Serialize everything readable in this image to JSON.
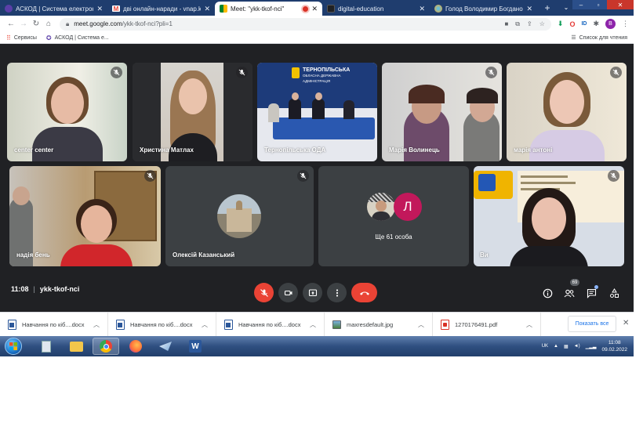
{
  "tabs": [
    {
      "title": "АСКОД | Система електронного",
      "favicon_color": "#5b3fa8",
      "active": false
    },
    {
      "title": "дві онлайн-наради - vnap.kre",
      "favicon_color": "#ea4335",
      "active": false
    },
    {
      "title": "Meet: \"ykk-tkof-nci\"",
      "favicon_color": "#00897b",
      "active": true
    },
    {
      "title": "digital-education",
      "favicon_color": "#202124",
      "active": false
    },
    {
      "title": "Голод Володимир Богданович",
      "favicon_color": "#4fc3f7",
      "active": false
    }
  ],
  "address": {
    "host": "meet.google.com",
    "path": "/ykk-tkof-nci?pli=1"
  },
  "profile_letter": "B",
  "bookmarks": {
    "apps": "Сервисы",
    "askod": "АСКОД | Система е...",
    "reading_list": "Список для чтения"
  },
  "tiles": [
    {
      "name": "center center"
    },
    {
      "name": "Христина Матлах"
    },
    {
      "name": "Тернопільська ОДА"
    },
    {
      "name": "Марія Волинець"
    },
    {
      "name": "марія антоні"
    },
    {
      "name": "надія бень"
    },
    {
      "name": "Олексій Казанський"
    },
    {
      "name": "Ви"
    }
  ],
  "more_people": {
    "label": "Ще 61 особа",
    "letter": "Л"
  },
  "oda_sign": {
    "line1": "ТЕРНОПІЛЬСЬКА",
    "line2": "ОБЛАСНА ДЕРЖАВНА",
    "line3": "АДМІНІСТРАЦІЯ"
  },
  "meeting": {
    "time": "11:08",
    "code": "ykk-tkof-nci",
    "participants_count": "69"
  },
  "downloads": [
    {
      "name": "Навчання по кіб....docx",
      "type": "docx"
    },
    {
      "name": "Навчання по кіб....docx",
      "type": "docx"
    },
    {
      "name": "Навчання по кіб....docx",
      "type": "docx"
    },
    {
      "name": "maxresdefault.jpg",
      "type": "jpg"
    },
    {
      "name": "1270176491.pdf",
      "type": "pdf"
    }
  ],
  "show_all": "Показать все",
  "tray": {
    "lang": "UK",
    "time": "11:08",
    "date": "09.02.2022"
  }
}
